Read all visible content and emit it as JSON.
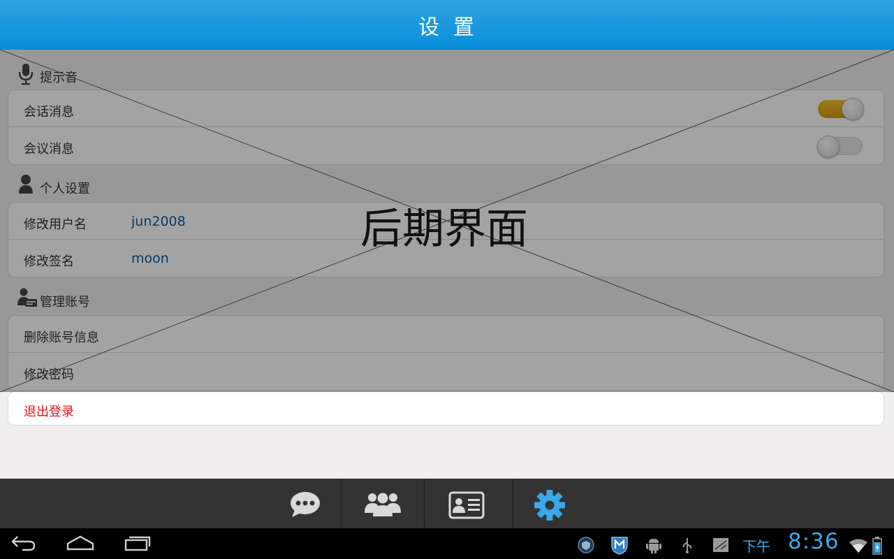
{
  "header": {
    "title": "设置"
  },
  "sections": {
    "notify": {
      "title": "提示音",
      "icon": "microphone-icon"
    },
    "personal": {
      "title": "个人设置",
      "icon": "person-icon"
    },
    "account": {
      "title": "管理账号",
      "icon": "account-card-icon"
    }
  },
  "notify_rows": {
    "chat": {
      "label": "会话消息",
      "toggle_on": true
    },
    "meeting": {
      "label": "会议消息",
      "toggle_on": false
    }
  },
  "personal_rows": {
    "username": {
      "label": "修改用户名",
      "value": "jun2008"
    },
    "signature": {
      "label": "修改签名",
      "value": "moon"
    }
  },
  "account_rows": {
    "delete": {
      "label": "删除账号信息"
    },
    "password": {
      "label": "修改密码"
    }
  },
  "logout": {
    "label": "退出登录",
    "color": "#e0141a"
  },
  "overlay": {
    "text": "后期界面"
  },
  "tabs": [
    "chat-bubble-icon",
    "contacts-group-icon",
    "contact-card-icon",
    "settings-gear-icon"
  ],
  "system_bar": {
    "ampm": "下午",
    "time": "8:36"
  },
  "colors": {
    "header": "#0a8fda",
    "active_tab": "#3aa8e8",
    "toggle_on": "#e6ad1b"
  }
}
